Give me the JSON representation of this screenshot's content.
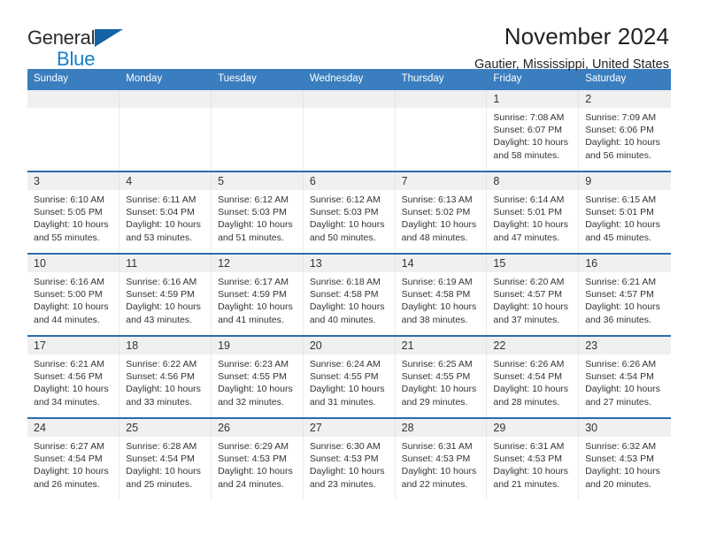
{
  "brand": {
    "name_part1": "General",
    "name_part2": "Blue",
    "logo_icon": "triangle-logo-icon",
    "accent_color": "#1481c9",
    "dark_color": "#1464a5"
  },
  "header": {
    "title": "November 2024",
    "location": "Gautier, Mississippi, United States"
  },
  "theme": {
    "header_blue": "#3a7ebf",
    "separator_blue": "#2b6cab",
    "daynum_band": "#f0f0f0"
  },
  "calendar": {
    "weekday_headers": [
      "Sunday",
      "Monday",
      "Tuesday",
      "Wednesday",
      "Thursday",
      "Friday",
      "Saturday"
    ],
    "weeks": [
      {
        "days": [
          {
            "num": "",
            "empty": true
          },
          {
            "num": "",
            "empty": true
          },
          {
            "num": "",
            "empty": true
          },
          {
            "num": "",
            "empty": true
          },
          {
            "num": "",
            "empty": true
          },
          {
            "num": "1",
            "sunrise": "Sunrise: 7:08 AM",
            "sunset": "Sunset: 6:07 PM",
            "daylight": "Daylight: 10 hours and 58 minutes."
          },
          {
            "num": "2",
            "sunrise": "Sunrise: 7:09 AM",
            "sunset": "Sunset: 6:06 PM",
            "daylight": "Daylight: 10 hours and 56 minutes."
          }
        ]
      },
      {
        "days": [
          {
            "num": "3",
            "sunrise": "Sunrise: 6:10 AM",
            "sunset": "Sunset: 5:05 PM",
            "daylight": "Daylight: 10 hours and 55 minutes."
          },
          {
            "num": "4",
            "sunrise": "Sunrise: 6:11 AM",
            "sunset": "Sunset: 5:04 PM",
            "daylight": "Daylight: 10 hours and 53 minutes."
          },
          {
            "num": "5",
            "sunrise": "Sunrise: 6:12 AM",
            "sunset": "Sunset: 5:03 PM",
            "daylight": "Daylight: 10 hours and 51 minutes."
          },
          {
            "num": "6",
            "sunrise": "Sunrise: 6:12 AM",
            "sunset": "Sunset: 5:03 PM",
            "daylight": "Daylight: 10 hours and 50 minutes."
          },
          {
            "num": "7",
            "sunrise": "Sunrise: 6:13 AM",
            "sunset": "Sunset: 5:02 PM",
            "daylight": "Daylight: 10 hours and 48 minutes."
          },
          {
            "num": "8",
            "sunrise": "Sunrise: 6:14 AM",
            "sunset": "Sunset: 5:01 PM",
            "daylight": "Daylight: 10 hours and 47 minutes."
          },
          {
            "num": "9",
            "sunrise": "Sunrise: 6:15 AM",
            "sunset": "Sunset: 5:01 PM",
            "daylight": "Daylight: 10 hours and 45 minutes."
          }
        ]
      },
      {
        "days": [
          {
            "num": "10",
            "sunrise": "Sunrise: 6:16 AM",
            "sunset": "Sunset: 5:00 PM",
            "daylight": "Daylight: 10 hours and 44 minutes."
          },
          {
            "num": "11",
            "sunrise": "Sunrise: 6:16 AM",
            "sunset": "Sunset: 4:59 PM",
            "daylight": "Daylight: 10 hours and 43 minutes."
          },
          {
            "num": "12",
            "sunrise": "Sunrise: 6:17 AM",
            "sunset": "Sunset: 4:59 PM",
            "daylight": "Daylight: 10 hours and 41 minutes."
          },
          {
            "num": "13",
            "sunrise": "Sunrise: 6:18 AM",
            "sunset": "Sunset: 4:58 PM",
            "daylight": "Daylight: 10 hours and 40 minutes."
          },
          {
            "num": "14",
            "sunrise": "Sunrise: 6:19 AM",
            "sunset": "Sunset: 4:58 PM",
            "daylight": "Daylight: 10 hours and 38 minutes."
          },
          {
            "num": "15",
            "sunrise": "Sunrise: 6:20 AM",
            "sunset": "Sunset: 4:57 PM",
            "daylight": "Daylight: 10 hours and 37 minutes."
          },
          {
            "num": "16",
            "sunrise": "Sunrise: 6:21 AM",
            "sunset": "Sunset: 4:57 PM",
            "daylight": "Daylight: 10 hours and 36 minutes."
          }
        ]
      },
      {
        "days": [
          {
            "num": "17",
            "sunrise": "Sunrise: 6:21 AM",
            "sunset": "Sunset: 4:56 PM",
            "daylight": "Daylight: 10 hours and 34 minutes."
          },
          {
            "num": "18",
            "sunrise": "Sunrise: 6:22 AM",
            "sunset": "Sunset: 4:56 PM",
            "daylight": "Daylight: 10 hours and 33 minutes."
          },
          {
            "num": "19",
            "sunrise": "Sunrise: 6:23 AM",
            "sunset": "Sunset: 4:55 PM",
            "daylight": "Daylight: 10 hours and 32 minutes."
          },
          {
            "num": "20",
            "sunrise": "Sunrise: 6:24 AM",
            "sunset": "Sunset: 4:55 PM",
            "daylight": "Daylight: 10 hours and 31 minutes."
          },
          {
            "num": "21",
            "sunrise": "Sunrise: 6:25 AM",
            "sunset": "Sunset: 4:55 PM",
            "daylight": "Daylight: 10 hours and 29 minutes."
          },
          {
            "num": "22",
            "sunrise": "Sunrise: 6:26 AM",
            "sunset": "Sunset: 4:54 PM",
            "daylight": "Daylight: 10 hours and 28 minutes."
          },
          {
            "num": "23",
            "sunrise": "Sunrise: 6:26 AM",
            "sunset": "Sunset: 4:54 PM",
            "daylight": "Daylight: 10 hours and 27 minutes."
          }
        ]
      },
      {
        "days": [
          {
            "num": "24",
            "sunrise": "Sunrise: 6:27 AM",
            "sunset": "Sunset: 4:54 PM",
            "daylight": "Daylight: 10 hours and 26 minutes."
          },
          {
            "num": "25",
            "sunrise": "Sunrise: 6:28 AM",
            "sunset": "Sunset: 4:54 PM",
            "daylight": "Daylight: 10 hours and 25 minutes."
          },
          {
            "num": "26",
            "sunrise": "Sunrise: 6:29 AM",
            "sunset": "Sunset: 4:53 PM",
            "daylight": "Daylight: 10 hours and 24 minutes."
          },
          {
            "num": "27",
            "sunrise": "Sunrise: 6:30 AM",
            "sunset": "Sunset: 4:53 PM",
            "daylight": "Daylight: 10 hours and 23 minutes."
          },
          {
            "num": "28",
            "sunrise": "Sunrise: 6:31 AM",
            "sunset": "Sunset: 4:53 PM",
            "daylight": "Daylight: 10 hours and 22 minutes."
          },
          {
            "num": "29",
            "sunrise": "Sunrise: 6:31 AM",
            "sunset": "Sunset: 4:53 PM",
            "daylight": "Daylight: 10 hours and 21 minutes."
          },
          {
            "num": "30",
            "sunrise": "Sunrise: 6:32 AM",
            "sunset": "Sunset: 4:53 PM",
            "daylight": "Daylight: 10 hours and 20 minutes."
          }
        ]
      }
    ]
  }
}
